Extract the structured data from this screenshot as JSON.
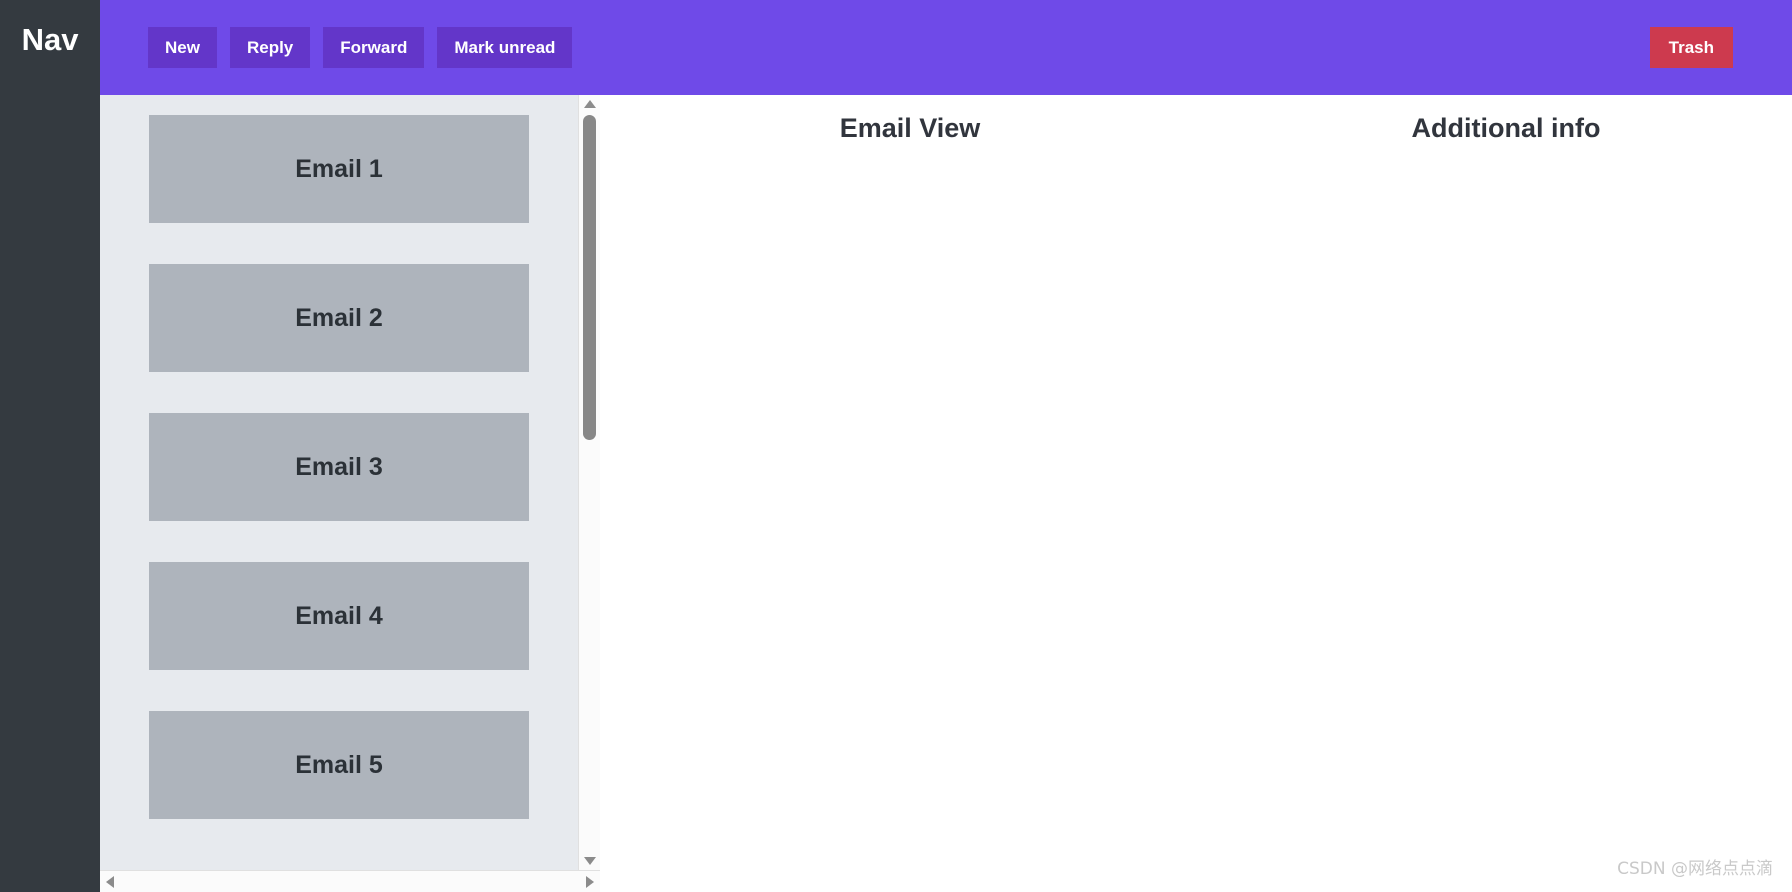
{
  "nav": {
    "title": "Nav"
  },
  "toolbar": {
    "buttons": [
      {
        "label": "New",
        "name": "new-button"
      },
      {
        "label": "Reply",
        "name": "reply-button"
      },
      {
        "label": "Forward",
        "name": "forward-button"
      },
      {
        "label": "Mark unread",
        "name": "mark-unread-button"
      }
    ],
    "trash_label": "Trash",
    "bar_color": "#6f4ae8",
    "button_color": "#6336c9",
    "trash_color": "#cd3a4e"
  },
  "email_list": {
    "panel_color": "#e7eaee",
    "item_color": "#aeb4bc",
    "items": [
      {
        "label": "Email 1"
      },
      {
        "label": "Email 2"
      },
      {
        "label": "Email 3"
      },
      {
        "label": "Email 4"
      },
      {
        "label": "Email 5"
      }
    ]
  },
  "scrollbars": {
    "vertical": {
      "up_icon": "arrow-up-icon",
      "down_icon": "arrow-down-icon",
      "thumb": "vertical-scroll-thumb"
    },
    "horizontal": {
      "left_icon": "arrow-left-icon",
      "right_icon": "arrow-right-icon"
    }
  },
  "panes": {
    "email_view_title": "Email View",
    "additional_info_title": "Additional info"
  },
  "watermark": {
    "text": "CSDN @网络点点滴"
  }
}
